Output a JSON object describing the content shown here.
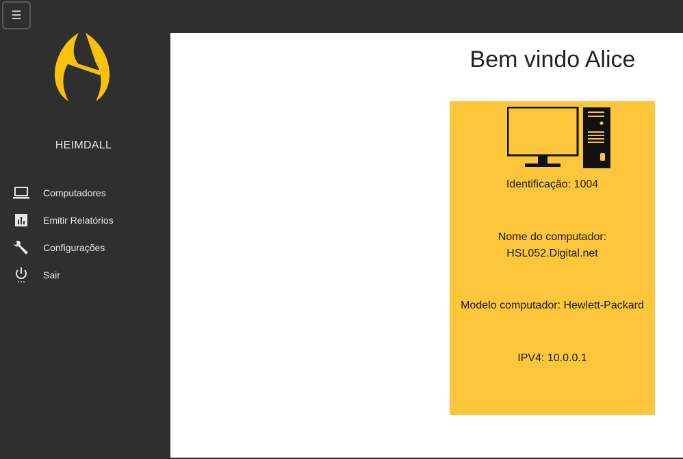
{
  "header": {
    "menu_button_label": "☰"
  },
  "sidebar": {
    "brand": "HEIMDALL",
    "items": [
      {
        "label": "Computadores",
        "icon": "laptop-icon"
      },
      {
        "label": "Emitir Relatórios",
        "icon": "bar-chart-icon"
      },
      {
        "label": "Configurações",
        "icon": "wrench-icon"
      },
      {
        "label": "Sair",
        "icon": "power-icon"
      }
    ]
  },
  "main": {
    "welcome": "Bem vindo Alice",
    "computer": {
      "id_line": "Identificação: 1004",
      "name_label": "Nome do computador:",
      "name_value": "HSL052.Digital.net",
      "model_line": "Modelo computador: Hewlett-Packard",
      "ipv4_line": "IPV4: 10.0.0.1"
    }
  },
  "colors": {
    "sidebar_bg": "#2f2f2f",
    "accent": "#fdc63b",
    "logo": "#f7c10c"
  }
}
